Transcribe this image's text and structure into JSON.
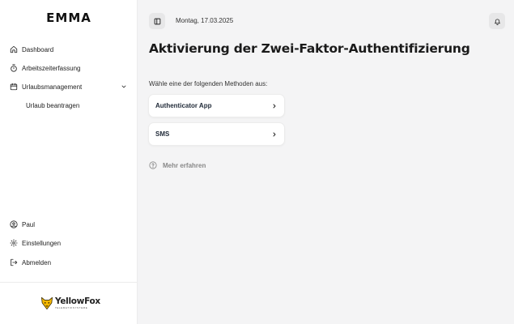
{
  "sidebar": {
    "brand": "EMMA",
    "nav": [
      {
        "label": "Dashboard",
        "icon": "home-icon"
      },
      {
        "label": "Arbeitszeiterfassung",
        "icon": "stopwatch-icon"
      },
      {
        "label": "Urlaubsmanagement",
        "icon": "calendar-icon",
        "expanded": true
      }
    ],
    "sub_nav": [
      {
        "label": "Urlaub beantragen"
      }
    ],
    "bottom": [
      {
        "label": "Paul",
        "icon": "user-circle-icon"
      },
      {
        "label": "Einstellungen",
        "icon": "gear-icon"
      },
      {
        "label": "Abmelden",
        "icon": "logout-icon"
      }
    ],
    "logo": {
      "name": "YellowFox",
      "tagline": "TELEMATIKSYSTEME"
    }
  },
  "header": {
    "date": "Montag, 17.03.2025",
    "toggle_icon": "sidebar-toggle-icon",
    "bell_icon": "bell-icon"
  },
  "main": {
    "title": "Aktivierung der Zwei-Faktor-Authentifizierung",
    "instruction": "Wähle eine der folgenden Methoden aus:",
    "methods": [
      {
        "label": "Authenticator App"
      },
      {
        "label": "SMS"
      }
    ],
    "learn_more": "Mehr erfahren"
  },
  "colors": {
    "sidebar_bg": "#ffffff",
    "main_bg": "#f4f4f5",
    "text": "#1f2937",
    "muted": "#888888",
    "logo_yellow": "#f5b800"
  }
}
